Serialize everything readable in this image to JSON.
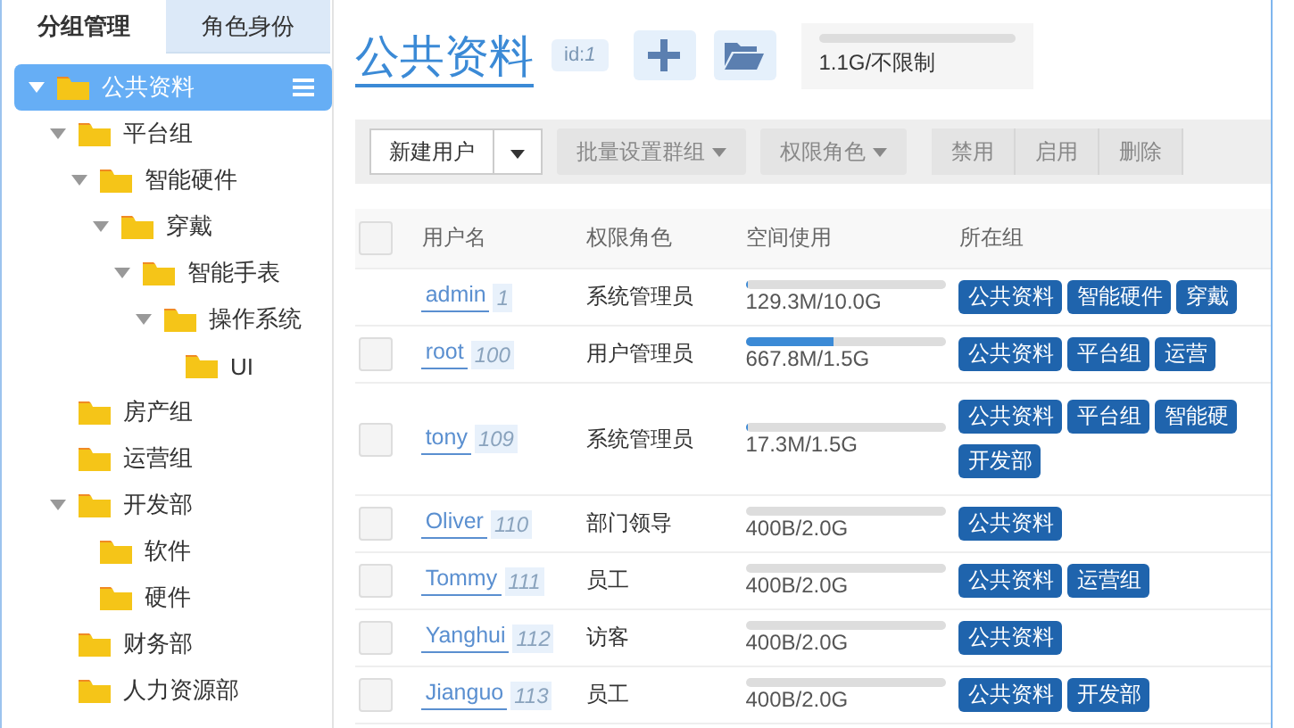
{
  "sidebar": {
    "tabs": [
      {
        "label": "分组管理",
        "selected": true
      },
      {
        "label": "角色身份",
        "selected": false
      }
    ],
    "tree": [
      {
        "label": "公共资料",
        "selected": true,
        "expanded": true,
        "children": [
          {
            "label": "平台组",
            "selected": false,
            "expanded": true,
            "children": [
              {
                "label": "智能硬件",
                "selected": false,
                "expanded": true,
                "children": [
                  {
                    "label": "穿戴",
                    "selected": false,
                    "expanded": true,
                    "children": [
                      {
                        "label": "智能手表",
                        "selected": false,
                        "expanded": true,
                        "children": [
                          {
                            "label": "操作系统",
                            "selected": false,
                            "expanded": true,
                            "children": [
                              {
                                "label": "UI",
                                "selected": false
                              }
                            ]
                          }
                        ]
                      }
                    ]
                  }
                ]
              }
            ]
          },
          {
            "label": "房产组",
            "selected": false
          },
          {
            "label": "运营组",
            "selected": false
          },
          {
            "label": "开发部",
            "selected": false,
            "expanded": true,
            "children": [
              {
                "label": "软件",
                "selected": false
              },
              {
                "label": "硬件",
                "selected": false
              }
            ]
          },
          {
            "label": "财务部",
            "selected": false
          },
          {
            "label": "人力资源部",
            "selected": false
          }
        ]
      }
    ]
  },
  "header": {
    "title": "公共资料",
    "id_badge": "id:*1*",
    "storage": {
      "level": 0,
      "reading": "1.1G/不限制"
    }
  },
  "toolbar": {
    "new_user": "新建用户",
    "buttons": [
      {
        "label": "批量设置群组",
        "kind": "dropdown"
      },
      {
        "label": "权限角色",
        "kind": "dropdown"
      },
      {
        "label": "禁用",
        "kind": "plain"
      },
      {
        "label": "启用",
        "kind": "plain"
      },
      {
        "label": "删除",
        "kind": "plain"
      }
    ]
  },
  "table": {
    "select_all_checked": false,
    "columns": [
      "用户名",
      "权限角色",
      "空间使用",
      "所在组"
    ],
    "rows": [
      {
        "name": "admin",
        "id": "1",
        "role": "系统管理员",
        "level": 0.013,
        "usage": "129.3M/10.0G",
        "groups": [
          "公共资料",
          "智能硬件",
          "穿戴"
        ],
        "selectable": false
      },
      {
        "name": "root",
        "id": "100",
        "role": "用户管理员",
        "level": 0.44,
        "usage": "667.8M/1.5G",
        "groups": [
          "公共资料",
          "平台组",
          "运营"
        ],
        "selectable": true,
        "checked": false
      },
      {
        "name": "tony",
        "id": "109",
        "role": "系统管理员",
        "level": 0.011,
        "usage": "17.3M/1.5G",
        "groups": [
          "公共资料",
          "平台组",
          "智能硬",
          "开发部"
        ],
        "selectable": true,
        "checked": false
      },
      {
        "name": "Oliver",
        "id": "110",
        "role": "部门领导",
        "level": 0,
        "usage": "400B/2.0G",
        "groups": [
          "公共资料"
        ],
        "selectable": true,
        "checked": false
      },
      {
        "name": "Tommy",
        "id": "111",
        "role": "员工",
        "level": 0,
        "usage": "400B/2.0G",
        "groups": [
          "公共资料",
          "运营组"
        ],
        "selectable": true,
        "checked": false
      },
      {
        "name": "Yanghui",
        "id": "112",
        "role": "访客",
        "level": 0,
        "usage": "400B/2.0G",
        "groups": [
          "公共资料"
        ],
        "selectable": true,
        "checked": false
      },
      {
        "name": "Jianguo",
        "id": "113",
        "role": "员工",
        "level": 0,
        "usage": "400B/2.0G",
        "groups": [
          "公共资料",
          "开发部"
        ],
        "selectable": true,
        "checked": false
      }
    ]
  }
}
